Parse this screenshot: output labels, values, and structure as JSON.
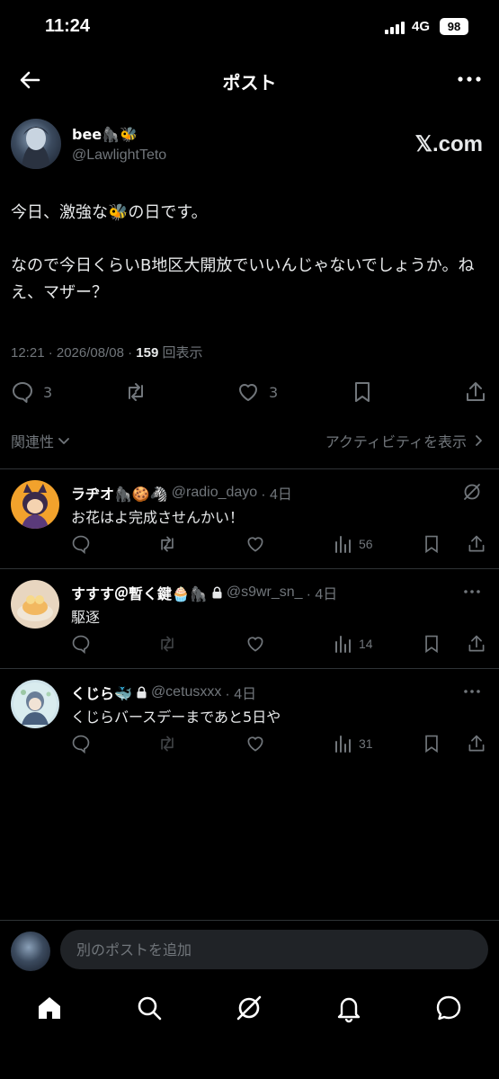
{
  "status_bar": {
    "time": "11:24",
    "network": "4G",
    "battery": "98"
  },
  "header": {
    "title": "ポスト"
  },
  "post": {
    "author_name": "bee🦍🐝",
    "author_handle": "@LawlightTeto",
    "source_label": "𝕏.com",
    "text_line1": "今日、激強な🐝の日です。",
    "text_line2": "なので今日くらいB地区大開放でいいんじゃないでしょうか。ねえ、マザー？",
    "timestamp": "12:21 · 2026/08/08 · ",
    "views_count": "159",
    "views_label": " 回表示",
    "reply_count": "3",
    "like_count": "3"
  },
  "sort": {
    "relevance_label": "関連性",
    "activity_label": "アクティビティを表示"
  },
  "replies": [
    {
      "name": "ラヂオ🦍🍪🦓",
      "handle": "@radio_dayo",
      "time": "· 4日",
      "text": "お花はよ完成させんかい！",
      "views": "56",
      "locked": false
    },
    {
      "name": "すすす＠暫く鍵🧁🦍",
      "handle": "@s9wr_sn_",
      "time": "· 4日",
      "text": "駆逐",
      "views": "14",
      "locked": true
    },
    {
      "name": "くじら🐳",
      "handle": "@cetusxxx",
      "time": "· 4日",
      "text": "くじらバースデーまであと5日や",
      "views": "31",
      "locked": true
    }
  ],
  "composer": {
    "placeholder": "別のポストを追加"
  },
  "colors": {
    "background": "#000000",
    "text": "#e7e9ea",
    "muted": "#71767b",
    "divider": "#2f3336",
    "input_bg": "#202327"
  },
  "icons": [
    "back-arrow-icon",
    "more-icon",
    "reply-icon",
    "repost-icon",
    "like-icon",
    "bookmark-icon",
    "share-icon",
    "views-icon",
    "grok-icon",
    "lock-icon",
    "home-icon",
    "search-icon",
    "notifications-icon",
    "messages-icon"
  ]
}
